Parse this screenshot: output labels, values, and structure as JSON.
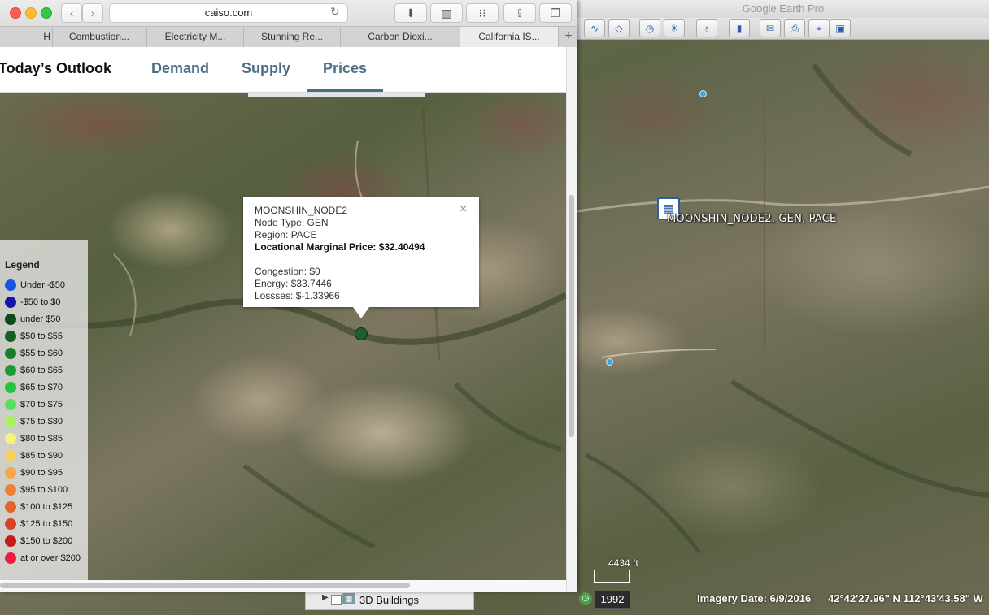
{
  "browser": {
    "address": "caiso.com",
    "tabs": [
      {
        "label": "H"
      },
      {
        "label": "Combustion..."
      },
      {
        "label": "Electricity M..."
      },
      {
        "label": "Stunning Re..."
      },
      {
        "label": "Carbon Dioxi..."
      },
      {
        "label": "California IS..."
      }
    ],
    "new_tab": "+"
  },
  "page_nav": {
    "title": "Today’s Outlook",
    "links": [
      {
        "label": "Demand"
      },
      {
        "label": "Supply"
      },
      {
        "label": "Prices"
      }
    ],
    "active": "Prices"
  },
  "popup": {
    "node": "MOONSHIN_NODE2",
    "node_type": "Node Type: GEN",
    "region": "Region: PACE",
    "lmp": "Locational Marginal Price: $32.40494",
    "separator": "------------------------------------------------------------------------",
    "congestion": "Congestion: $0",
    "energy": "Energy: $33.7446",
    "losses": "Lossses: $-1.33966",
    "close": "×"
  },
  "legend": {
    "title": "Legend",
    "items": [
      {
        "label": "Under -$50",
        "color": "#1a55e0"
      },
      {
        "label": "-$50 to $0",
        "color": "#1414a8"
      },
      {
        "label": "under $50",
        "color": "#0b4a1a"
      },
      {
        "label": "$50 to $55",
        "color": "#14601f"
      },
      {
        "label": "$55 to $60",
        "color": "#1a7d2b"
      },
      {
        "label": "$60 to $65",
        "color": "#1d9a35"
      },
      {
        "label": "$65 to $70",
        "color": "#25c43f"
      },
      {
        "label": "$70 to $75",
        "color": "#55e25a"
      },
      {
        "label": "$75 to $80",
        "color": "#aaf062"
      },
      {
        "label": "$80 to $85",
        "color": "#f4f37a"
      },
      {
        "label": "$85 to $90",
        "color": "#f8cf60"
      },
      {
        "label": "$90 to $95",
        "color": "#f5a84a"
      },
      {
        "label": "$95 to $100",
        "color": "#ee8233"
      },
      {
        "label": "$100 to $125",
        "color": "#e2632a"
      },
      {
        "label": "$125 to $150",
        "color": "#d64424"
      },
      {
        "label": "$150 to $200",
        "color": "#c81a1a"
      },
      {
        "label": "at or over $200",
        "color": "#ee1a45"
      }
    ]
  },
  "google_earth": {
    "title": "Google Earth Pro",
    "placemark": "MOONSHIN_NODE2, GEN, PACE",
    "scale": "4434 ft",
    "year": "1992",
    "imagery_date": "Imagery Date: 6/9/2016",
    "coordinates": "42°42'27.96\" N   112°43'43.58\" W",
    "layers_item": "3D Buildings",
    "toolbar_icons": [
      "path-icon",
      "polygon-icon",
      "overlay-icon",
      "tour-icon",
      "historical-imagery-icon",
      "sun-icon",
      "planets-icon",
      "ruler-icon",
      "email-icon",
      "print-icon",
      "maps-icon",
      "save-image-icon"
    ]
  }
}
